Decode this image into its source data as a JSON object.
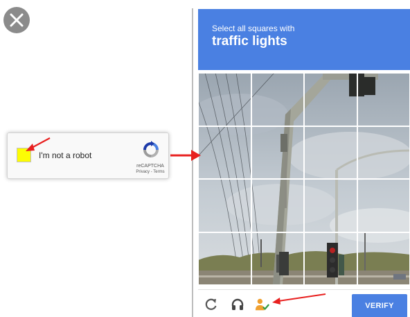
{
  "anchor": {
    "label": "I'm not a robot",
    "brand": "reCAPTCHA",
    "links": "Privacy - Terms",
    "checkbox_color": "#fcfc05"
  },
  "challenge": {
    "instruction_small": "Select all squares with",
    "instruction_big": "traffic lights",
    "header_color": "#4a80e2",
    "grid_rows": 4,
    "grid_cols": 4
  },
  "footer": {
    "reload_icon": "reload-icon",
    "audio_icon": "headphones-icon",
    "info_icon": "person-check-icon",
    "verify_label": "VERIFY"
  },
  "icons": {
    "close": "close-icon",
    "recaptcha_logo": "recaptcha-logo-icon"
  },
  "annotations": {
    "color": "#e8201f",
    "count": 3
  }
}
